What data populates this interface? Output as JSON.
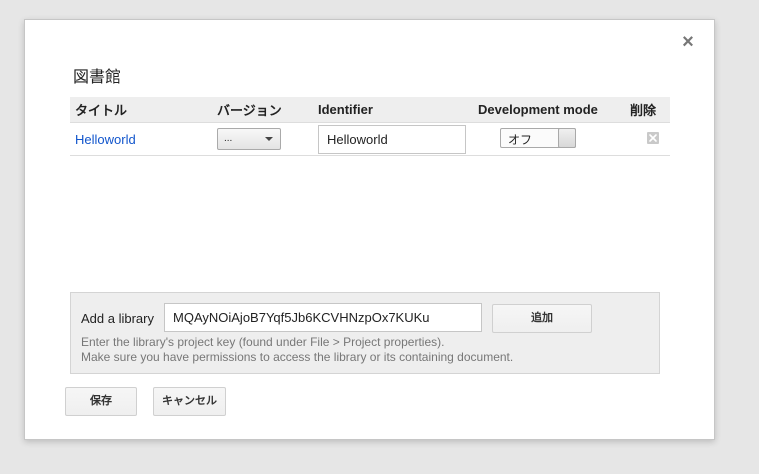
{
  "dialog": {
    "title": "図書館",
    "close_glyph": "×"
  },
  "table": {
    "headers": [
      "タイトル",
      "バージョン",
      "Identifier",
      "Development mode",
      "削除"
    ],
    "rows": [
      {
        "title": "Helloworld",
        "version": "...",
        "identifier": "Helloworld",
        "dev_mode": "オフ"
      }
    ]
  },
  "add_library": {
    "label": "Add a library",
    "key_value": "MQAyNOiAjoB7Yqf5Jb6KCVHNzpOx7KUKu",
    "add_button": "追加",
    "hint_line1": "Enter the library's project key (found under File > Project properties).",
    "hint_line2": "Make sure you have permissions to access the library or its containing document."
  },
  "footer": {
    "save_label": "保存",
    "cancel_label": "キャンセル"
  },
  "colors": {
    "link": "#1155cc",
    "panel_bg": "#eeeeee",
    "hint_text": "#777777"
  },
  "icons": {
    "close": "close-icon",
    "delete": "delete-icon",
    "dropdown": "chevron-down-icon"
  }
}
